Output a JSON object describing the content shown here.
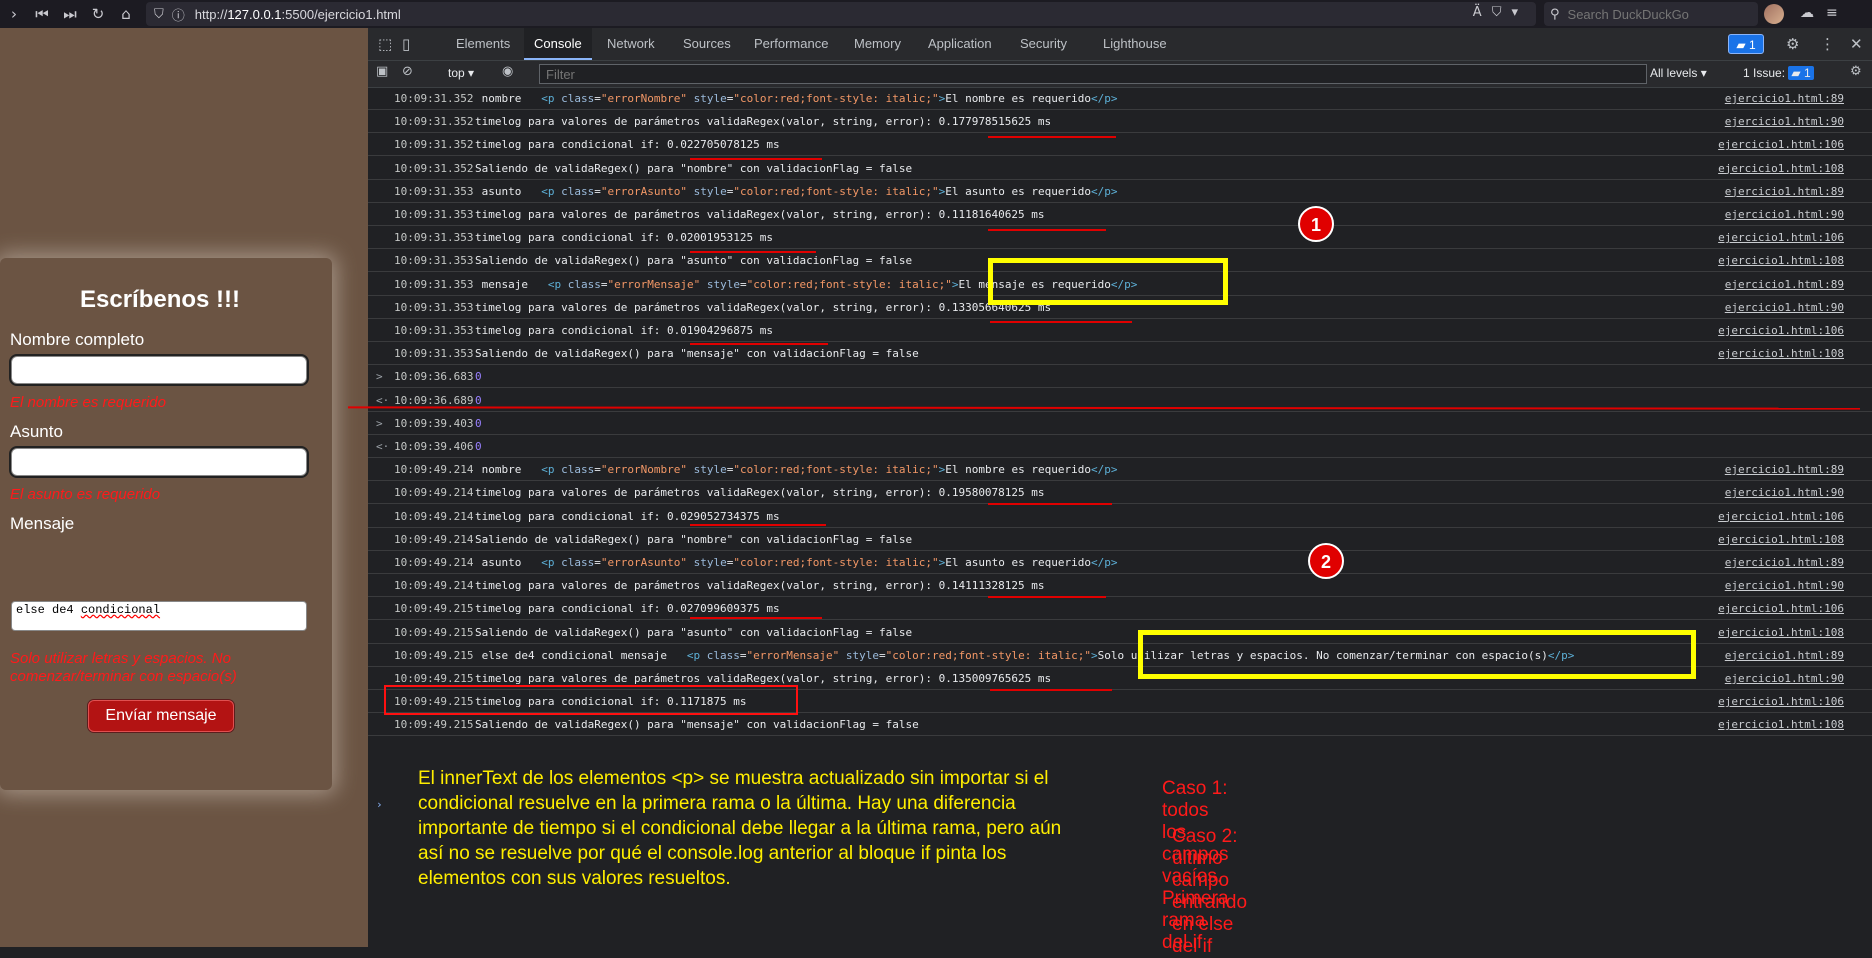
{
  "browser": {
    "url_prefix": "http://",
    "url_host": "127.0.0.1",
    "url_rest": ":5500/ejercicio1.html",
    "search_placeholder": "Search DuckDuckGo"
  },
  "form": {
    "title": "Escríbenos !!!",
    "nombre_label": "Nombre completo",
    "nombre_error": "El nombre es requerido",
    "asunto_label": "Asunto",
    "asunto_error": "El asunto es requerido",
    "mensaje_label": "Mensaje",
    "mensaje_value_1": "else de4",
    "mensaje_value_2": "condicional",
    "mensaje_error": "Solo utilizar letras y espacios. No comenzar/terminar con espacio(s)",
    "send_label": "Envíar mensaje"
  },
  "devtools": {
    "tabs": [
      "Elements",
      "Console",
      "Network",
      "Sources",
      "Performance",
      "Memory",
      "Application",
      "Security",
      "Lighthouse"
    ],
    "messages_count": "1",
    "context": "top",
    "filter_placeholder": "Filter",
    "levels": "All levels",
    "issues_label": "1 Issue:",
    "issues_count": "1"
  },
  "console_rows": [
    {
      "ts": "10:09:31.352",
      "label": "nombre",
      "cls": "errorNombre",
      "inner": "El nombre es requerido",
      "src": "ejercicio1.html:89"
    },
    {
      "ts": "10:09:31.352",
      "text": "timelog para valores de parámetros validaRegex(valor, string, error): 0.177978515625 ms",
      "src": "ejercicio1.html:90"
    },
    {
      "ts": "10:09:31.352",
      "text": "timelog para condicional if: 0.022705078125 ms",
      "src": "ejercicio1.html:106"
    },
    {
      "ts": "10:09:31.352",
      "text": "Saliendo de validaRegex() para \"nombre\" con validacionFlag = false",
      "src": "ejercicio1.html:108"
    },
    {
      "ts": "10:09:31.353",
      "label": "asunto",
      "cls": "errorAsunto",
      "inner": "El asunto es requerido",
      "src": "ejercicio1.html:89"
    },
    {
      "ts": "10:09:31.353",
      "text": "timelog para valores de parámetros validaRegex(valor, string, error): 0.11181640625 ms",
      "src": "ejercicio1.html:90"
    },
    {
      "ts": "10:09:31.353",
      "text": "timelog para condicional if: 0.02001953125 ms",
      "src": "ejercicio1.html:106"
    },
    {
      "ts": "10:09:31.353",
      "text": "Saliendo de validaRegex() para \"asunto\" con validacionFlag = false",
      "src": "ejercicio1.html:108"
    },
    {
      "ts": "10:09:31.353",
      "label": "mensaje",
      "cls": "errorMensaje",
      "inner": "El mensaje es requerido",
      "src": "ejercicio1.html:89"
    },
    {
      "ts": "10:09:31.353",
      "text": "timelog para valores de parámetros validaRegex(valor, string, error): 0.133056640625 ms",
      "src": "ejercicio1.html:90"
    },
    {
      "ts": "10:09:31.353",
      "text": "timelog para condicional if: 0.01904296875 ms",
      "src": "ejercicio1.html:106"
    },
    {
      "ts": "10:09:31.353",
      "text": "Saliendo de validaRegex() para \"mensaje\" con validacionFlag = false",
      "src": "ejercicio1.html:108"
    },
    {
      "ts": "10:09:36.683",
      "chev": ">",
      "num": "0"
    },
    {
      "ts": "10:09:36.689",
      "chev": "<·",
      "num": "0"
    },
    {
      "ts": "10:09:39.403",
      "chev": ">",
      "num": "0"
    },
    {
      "ts": "10:09:39.406",
      "chev": "<·",
      "num": "0"
    },
    {
      "ts": "10:09:49.214",
      "label": "nombre",
      "cls": "errorNombre",
      "inner": "El nombre es requerido",
      "src": "ejercicio1.html:89"
    },
    {
      "ts": "10:09:49.214",
      "text": "timelog para valores de parámetros validaRegex(valor, string, error): 0.19580078125 ms",
      "src": "ejercicio1.html:90"
    },
    {
      "ts": "10:09:49.214",
      "text": "timelog para condicional if: 0.029052734375 ms",
      "src": "ejercicio1.html:106"
    },
    {
      "ts": "10:09:49.214",
      "text": "Saliendo de validaRegex() para \"nombre\" con validacionFlag = false",
      "src": "ejercicio1.html:108"
    },
    {
      "ts": "10:09:49.214",
      "label": "asunto",
      "cls": "errorAsunto",
      "inner": "El asunto es requerido",
      "src": "ejercicio1.html:89"
    },
    {
      "ts": "10:09:49.214",
      "text": "timelog para valores de parámetros validaRegex(valor, string, error): 0.14111328125 ms",
      "src": "ejercicio1.html:90"
    },
    {
      "ts": "10:09:49.215",
      "text": "timelog para condicional if: 0.027099609375 ms",
      "src": "ejercicio1.html:106"
    },
    {
      "ts": "10:09:49.215",
      "text": "Saliendo de validaRegex() para \"asunto\" con validacionFlag = false",
      "src": "ejercicio1.html:108"
    },
    {
      "ts": "10:09:49.215",
      "label": "else de4 condicional mensaje",
      "cls": "errorMensaje",
      "inner": "Solo utilizar letras y espacios. No comenzar/terminar con espacio(s)",
      "src": "ejercicio1.html:89"
    },
    {
      "ts": "10:09:49.215",
      "text": "timelog para valores de parámetros validaRegex(valor, string, error): 0.135009765625 ms",
      "src": "ejercicio1.html:90"
    },
    {
      "ts": "10:09:49.215",
      "text": "timelog para condicional if: 0.1171875 ms",
      "src": "ejercicio1.html:106"
    },
    {
      "ts": "10:09:49.215",
      "text": "Saliendo de validaRegex() para \"mensaje\" con validacionFlag = false",
      "src": "ejercicio1.html:108"
    }
  ],
  "annotations": {
    "circle_1": "1",
    "circle_2": "2",
    "note": "El innerText de los elementos <p> se muestra actualizado sin importar si el condicional resuelve en la primera rama o la última. Hay una diferencia importante de tiempo si el condicional debe llegar a la última rama, pero aún así no se resuelve por qué el console.log anterior al bloque if pinta los elementos con sus valores resueltos.",
    "caso1": "Caso 1: todos los campos vacíos. Primera rama del if",
    "caso2": "Caso 2: último campo entrando en else del if"
  },
  "colors": {
    "accent_red": "#e00000",
    "highlight_yellow": "#ffff00",
    "note_text": "#ffee00",
    "page_bg": "#6b5443"
  }
}
